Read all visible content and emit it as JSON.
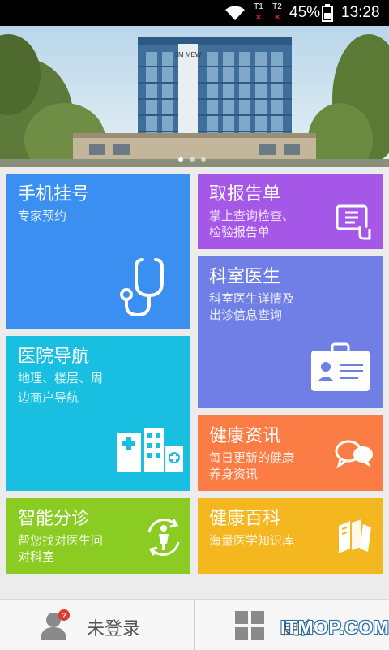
{
  "status_bar": {
    "battery_percent": "45%",
    "time": "13:28",
    "sim1_label": "T1",
    "sim2_label": "T2",
    "sim_x": "×"
  },
  "banner": {
    "slide_count": 3,
    "active_slide": 0,
    "building_sign": "3M MEW"
  },
  "tiles": {
    "mobile_registration": {
      "title": "手机挂号",
      "subtitle": "专家预约",
      "color": "#3a8ff0",
      "icon": "stethoscope-icon"
    },
    "get_report": {
      "title": "取报告单",
      "subtitle_line1": "掌上查询检查、",
      "subtitle_line2": "检验报告单",
      "color": "#a557e8",
      "icon": "report-touch-icon"
    },
    "department_doctor": {
      "title": "科室医生",
      "subtitle_line1": "科室医生详情及",
      "subtitle_line2": "出诊信息查询",
      "color": "#6f7fe6",
      "icon": "id-card-icon"
    },
    "hospital_navigation": {
      "title": "医院导航",
      "subtitle_line1": "地理、楼层、周",
      "subtitle_line2": "边商户导航",
      "color": "#18bfe0",
      "icon": "hospital-building-icon"
    },
    "health_news": {
      "title": "健康资讯",
      "subtitle_line1": "每日更新的健康",
      "subtitle_line2": "养身资讯",
      "color": "#fb7d45",
      "icon": "chat-bubbles-icon"
    },
    "smart_triage": {
      "title": "智能分诊",
      "subtitle_line1": "帮您找对医生问",
      "subtitle_line2": "对科室",
      "color": "#8bcc22",
      "icon": "person-refresh-icon"
    },
    "health_encyclopedia": {
      "title": "健康百科",
      "subtitle": "海量医学知识库",
      "color": "#f5b71f",
      "icon": "books-icon"
    }
  },
  "bottom_bar": {
    "login_label": "未登录",
    "more_label": "更多",
    "badge_text": "?",
    "watermark": "ITMOP.COM"
  }
}
